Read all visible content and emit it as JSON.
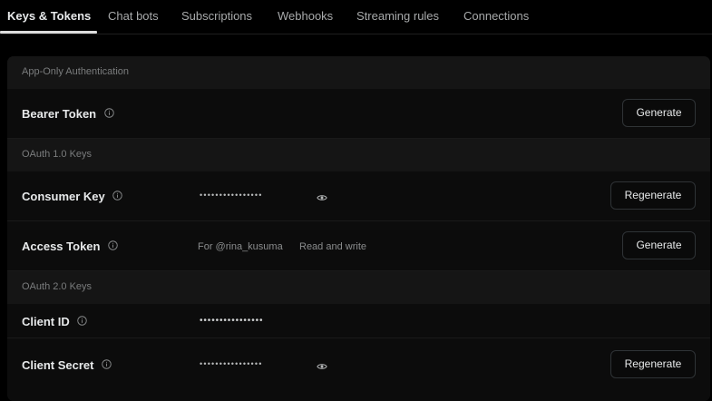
{
  "tabs": [
    {
      "label": "Keys & Tokens",
      "active": true
    },
    {
      "label": "Chat bots"
    },
    {
      "label": "Subscriptions"
    },
    {
      "label": "Webhooks"
    },
    {
      "label": "Streaming rules"
    },
    {
      "label": "Connections"
    }
  ],
  "sections": {
    "app_only": {
      "header": "App-Only Authentication",
      "bearer_token": {
        "label": "Bearer Token",
        "button": "Generate"
      }
    },
    "oauth1": {
      "header": "OAuth 1.0 Keys",
      "consumer_key": {
        "label": "Consumer Key",
        "masked": "••••••••••••••••",
        "button": "Regenerate"
      },
      "access_token": {
        "label": "Access Token",
        "owner": "For @rina_kusuma",
        "permission": "Read and write",
        "button": "Generate"
      }
    },
    "oauth2": {
      "header": "OAuth 2.0 Keys",
      "client_id": {
        "label": "Client ID",
        "masked": "••••••••••••••••"
      },
      "client_secret": {
        "label": "Client Secret",
        "masked": "••••••••••••••••",
        "button": "Regenerate"
      }
    }
  },
  "icons": {
    "info": "info-circle-icon",
    "eye": "eye-icon"
  },
  "colors": {
    "background": "#000000",
    "card": "#0e0e0e",
    "section_header": "#151515",
    "text_primary": "#e7e9ea",
    "text_muted": "#8a8c8d",
    "button_border": "#2f3336"
  }
}
